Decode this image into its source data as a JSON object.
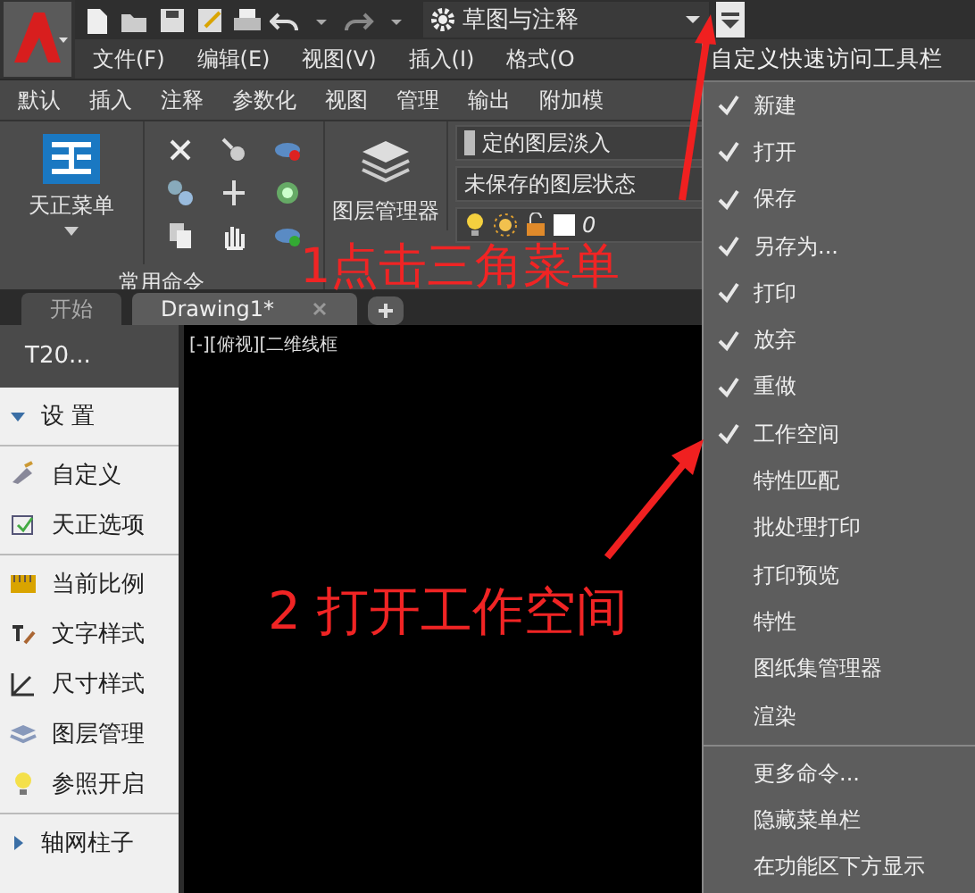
{
  "quick_access": {
    "workspace": "草图与注释"
  },
  "menu_bar": [
    "文件(F)",
    "编辑(E)",
    "视图(V)",
    "插入(I)",
    "格式(O"
  ],
  "ribbon_tabs": [
    "默认",
    "插入",
    "注释",
    "参数化",
    "视图",
    "管理",
    "输出",
    "附加模"
  ],
  "ribbon": {
    "tianzheng_button": "天正菜单",
    "panel_title": "常用命令",
    "layer_manager": "图层管理器",
    "layer_fields": [
      "定的图层淡入",
      "未保存的图层状态"
    ],
    "current_layer": "0"
  },
  "doc_tabs": [
    {
      "label": "开始",
      "selected": false
    },
    {
      "label": "Drawing1*",
      "selected": true
    }
  ],
  "palette": {
    "title": "T20...",
    "sections": [
      [
        {
          "kind": "group",
          "label": "设 置",
          "expanded": true
        }
      ],
      [
        {
          "kind": "command",
          "label": "自定义"
        },
        {
          "kind": "command",
          "label": "天正选项"
        }
      ],
      [
        {
          "kind": "command",
          "label": "当前比例"
        },
        {
          "kind": "command",
          "label": "文字样式"
        },
        {
          "kind": "command",
          "label": "尺寸样式"
        },
        {
          "kind": "command",
          "label": "图层管理"
        },
        {
          "kind": "command",
          "label": "参照开启"
        }
      ],
      [
        {
          "kind": "group",
          "label": "轴网柱子",
          "expanded": false
        }
      ]
    ]
  },
  "viewport": {
    "label": "[-][俯视][二维线框"
  },
  "qat_menu": {
    "title": "自定义快速访问工具栏",
    "items": [
      {
        "label": "新建",
        "checked": true
      },
      {
        "label": "打开",
        "checked": true
      },
      {
        "label": "保存",
        "checked": true
      },
      {
        "label": "另存为...",
        "checked": true
      },
      {
        "label": "打印",
        "checked": true
      },
      {
        "label": "放弃",
        "checked": true
      },
      {
        "label": "重做",
        "checked": true
      },
      {
        "label": "工作空间",
        "checked": true
      },
      {
        "label": "特性匹配",
        "checked": false
      },
      {
        "label": "批处理打印",
        "checked": false
      },
      {
        "label": "打印预览",
        "checked": false
      },
      {
        "label": "特性",
        "checked": false
      },
      {
        "label": "图纸集管理器",
        "checked": false
      },
      {
        "label": "渲染",
        "checked": false
      }
    ],
    "more_items": [
      "更多命令...",
      "隐藏菜单栏",
      "在功能区下方显示"
    ]
  },
  "annotations": [
    {
      "text": "1点击三角菜单"
    },
    {
      "text": "2 打开工作空间"
    }
  ]
}
